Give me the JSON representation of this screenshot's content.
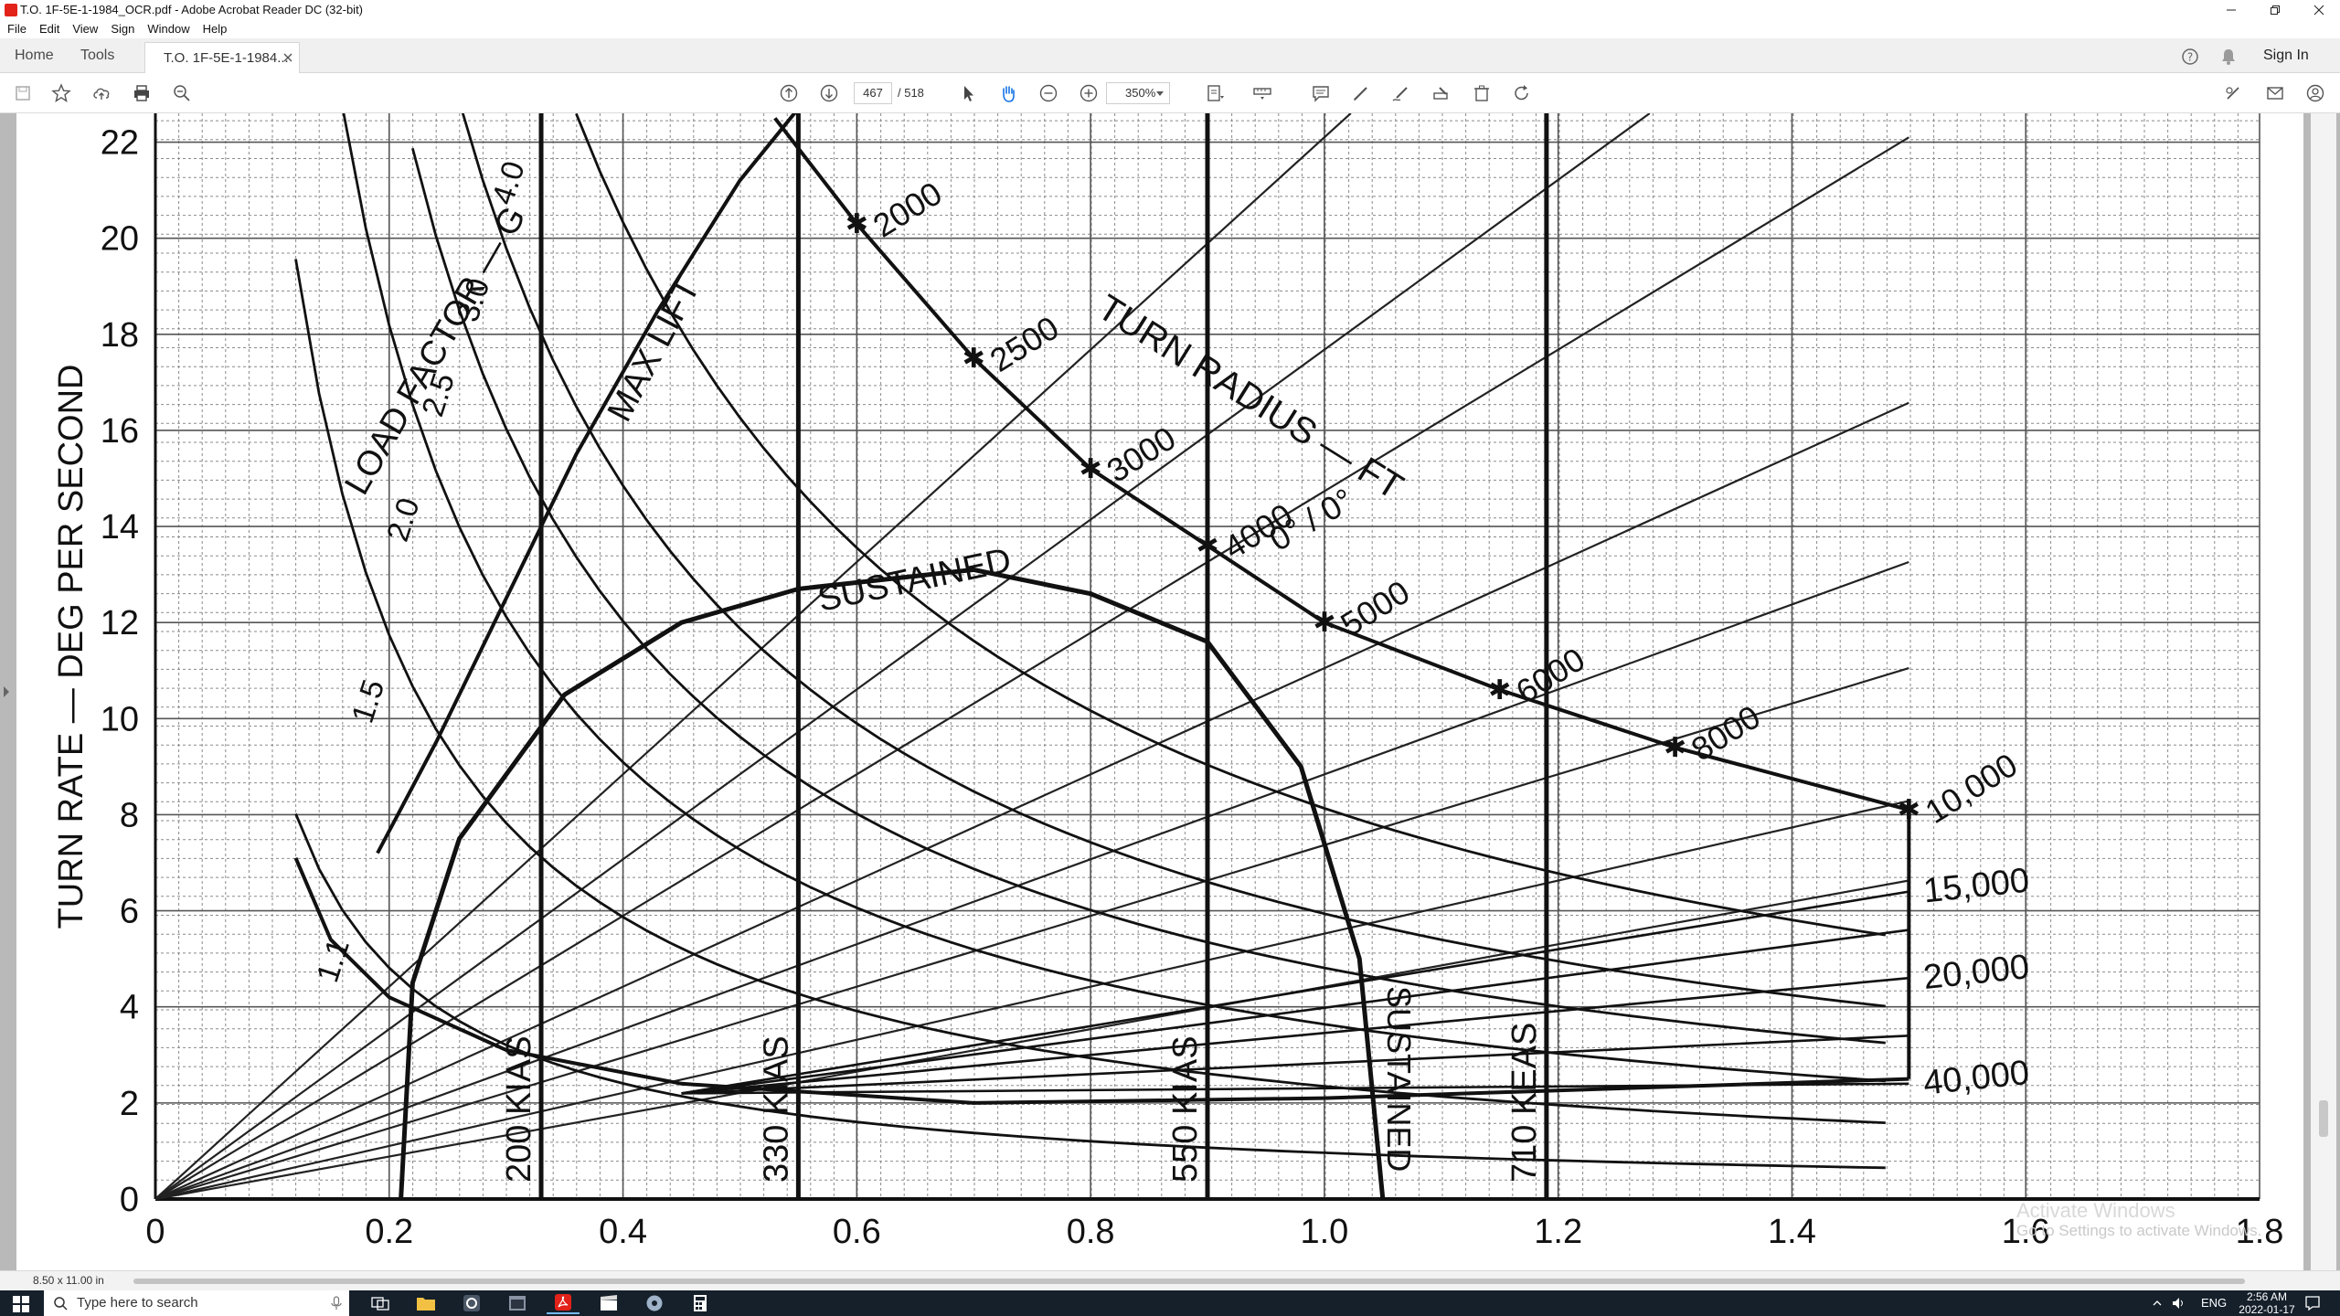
{
  "window": {
    "title": "T.O. 1F-5E-1-1984_OCR.pdf - Adobe Acrobat Reader DC (32-bit)"
  },
  "menu": [
    "File",
    "Edit",
    "View",
    "Sign",
    "Window",
    "Help"
  ],
  "tabs": {
    "home": "Home",
    "tools": "Tools",
    "document": "T.O. 1F-5E-1-1984..."
  },
  "header": {
    "sign_in": "Sign In"
  },
  "toolbar": {
    "page_current": "467",
    "page_total": "/ 518",
    "zoom": "350%"
  },
  "status": {
    "page_size": "8.50 x 11.00 in"
  },
  "watermark": {
    "line1": "Activate Windows",
    "line2": "Go to Settings to activate Windows."
  },
  "taskbar": {
    "search_placeholder": "Type here to search",
    "language": "ENG",
    "time": "2:56 AM",
    "date": "2022-01-17"
  },
  "chart_data": {
    "type": "line",
    "ylabel": "TURN RATE — DEG PER SECOND",
    "x_ticks": [
      "0",
      "0.2",
      "0.4",
      "0.6",
      "0.8",
      "1.0",
      "1.2",
      "1.4",
      "1.6",
      "1.8"
    ],
    "y_ticks": [
      "0",
      "2",
      "4",
      "6",
      "8",
      "10",
      "12",
      "14",
      "16",
      "18",
      "20",
      "22"
    ],
    "xlim": [
      0,
      1.8
    ],
    "ylim": [
      0,
      22.6
    ],
    "grid": true,
    "labels": {
      "load_factor": "LOAD FACTOR — G",
      "max_lift": "MAX LIFT",
      "turn_radius": "TURN RADIUS — FT",
      "sustained_top": "SUSTAINED",
      "sustained_right": "SUSTAINED",
      "sustained_note": "0° / 0°"
    },
    "g_curves": [
      {
        "label": "1.1",
        "g": 1.1
      },
      {
        "label": "1.5",
        "g": 1.5
      },
      {
        "label": "2.0",
        "g": 2.0
      },
      {
        "label": "2.5",
        "g": 2.5
      },
      {
        "label": "3.0",
        "g": 3.0
      },
      {
        "label": "4.0",
        "g": 4.0
      }
    ],
    "radius_lines": [
      {
        "label": "2000",
        "radius": 2000
      },
      {
        "label": "2500",
        "radius": 2500
      },
      {
        "label": "3000",
        "radius": 3000
      },
      {
        "label": "4000",
        "radius": 4000
      },
      {
        "label": "5000",
        "radius": 5000
      },
      {
        "label": "6000",
        "radius": 6000
      },
      {
        "label": "8000",
        "radius": 8000
      },
      {
        "label": "10,000",
        "radius": 10000
      }
    ],
    "altitude_labels": [
      {
        "label": "15,000",
        "y": 6.4
      },
      {
        "label": "20,000",
        "y": 4.6
      },
      {
        "label": "40,000",
        "y": 2.4
      }
    ],
    "speed_lines": [
      {
        "label": "200 KIAS",
        "x": 0.33
      },
      {
        "label": "330 KIAS",
        "x": 0.55
      },
      {
        "label": "550 KIAS",
        "x": 0.9
      },
      {
        "label": "710 KEAS",
        "x": 1.19
      }
    ],
    "sustained_curve": [
      [
        0.21,
        0
      ],
      [
        0.22,
        4.5
      ],
      [
        0.26,
        7.5
      ],
      [
        0.35,
        10.5
      ],
      [
        0.45,
        12
      ],
      [
        0.55,
        12.7
      ],
      [
        0.7,
        13.1
      ],
      [
        0.8,
        12.6
      ],
      [
        0.9,
        11.6
      ],
      [
        0.98,
        9
      ],
      [
        1.03,
        5
      ],
      [
        1.05,
        0
      ]
    ],
    "max_lift_curve": [
      [
        0.19,
        7.2
      ],
      [
        0.24,
        9.5
      ],
      [
        0.3,
        12.5
      ],
      [
        0.36,
        15.5
      ],
      [
        0.43,
        18.5
      ],
      [
        0.5,
        21.2
      ],
      [
        0.56,
        23
      ]
    ],
    "envelope_top": [
      [
        0.53,
        22.5
      ],
      [
        0.6,
        20.3
      ],
      [
        0.7,
        17.5
      ],
      [
        0.8,
        15.2
      ],
      [
        0.9,
        13.6
      ],
      [
        1.0,
        12.0
      ],
      [
        1.15,
        10.6
      ],
      [
        1.3,
        9.4
      ],
      [
        1.5,
        8.1
      ]
    ],
    "envelope_bottom": [
      [
        0.12,
        7.1
      ],
      [
        0.15,
        5.4
      ],
      [
        0.2,
        4.2
      ],
      [
        0.3,
        3.1
      ],
      [
        0.45,
        2.4
      ],
      [
        0.7,
        2.0
      ],
      [
        1.0,
        2.1
      ],
      [
        1.5,
        2.5
      ]
    ]
  }
}
